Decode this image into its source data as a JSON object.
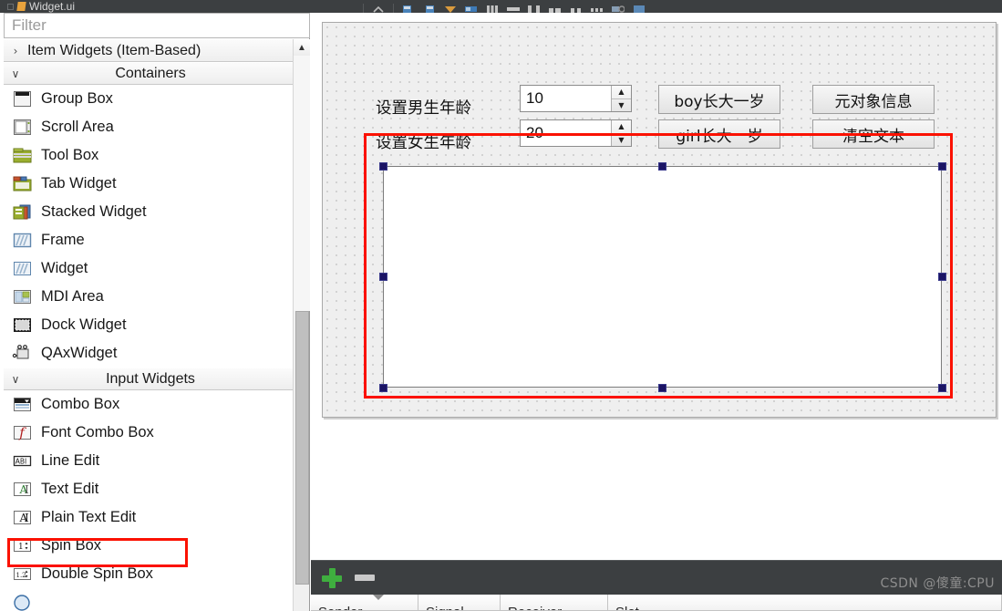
{
  "topbar": {
    "tab_label": "Widget.ui",
    "close_icon": "close-icon",
    "doc_icon": "ui-file-icon",
    "toolbar_icons": [
      "edit-widgets-icon",
      "edit-signals-icon",
      "edit-buddies-icon",
      "edit-tab-order-icon",
      "layout-horizontal-icon",
      "layout-vertical-icon",
      "layout-splitter-h-icon",
      "layout-splitter-v-icon",
      "layout-grid-icon",
      "layout-form-icon",
      "break-layout-icon",
      "adjust-size-icon"
    ]
  },
  "widget_box": {
    "filter": {
      "value": "",
      "placeholder": "Filter"
    },
    "groups": [
      {
        "title": "Item Widgets (Item-Based)",
        "expanded": false,
        "chevron": "chevron-right-icon",
        "align": "left",
        "items": []
      },
      {
        "title": "Containers",
        "expanded": true,
        "chevron": "chevron-down-icon",
        "align": "center",
        "items": [
          {
            "label": "Group Box",
            "icon": "group-box-icon"
          },
          {
            "label": "Scroll Area",
            "icon": "scroll-area-icon"
          },
          {
            "label": "Tool Box",
            "icon": "tool-box-icon"
          },
          {
            "label": "Tab Widget",
            "icon": "tab-widget-icon"
          },
          {
            "label": "Stacked Widget",
            "icon": "stacked-widget-icon"
          },
          {
            "label": "Frame",
            "icon": "frame-icon"
          },
          {
            "label": "Widget",
            "icon": "widget-icon"
          },
          {
            "label": "MDI Area",
            "icon": "mdi-area-icon"
          },
          {
            "label": "Dock Widget",
            "icon": "dock-widget-icon"
          },
          {
            "label": "QAxWidget",
            "icon": "qax-widget-icon"
          }
        ]
      },
      {
        "title": "Input Widgets",
        "expanded": true,
        "chevron": "chevron-down-icon",
        "align": "center",
        "items": [
          {
            "label": "Combo Box",
            "icon": "combo-box-icon"
          },
          {
            "label": "Font Combo Box",
            "icon": "font-combo-box-icon"
          },
          {
            "label": "Line Edit",
            "icon": "line-edit-icon"
          },
          {
            "label": "Text Edit",
            "icon": "text-edit-icon"
          },
          {
            "label": "Plain Text Edit",
            "icon": "plain-text-edit-icon",
            "highlighted": true
          },
          {
            "label": "Spin Box",
            "icon": "spin-box-icon"
          },
          {
            "label": "Double Spin Box",
            "icon": "double-spin-box-icon"
          }
        ]
      }
    ],
    "scrollbar": {
      "up_arrow": "chevron-up-icon"
    }
  },
  "form": {
    "labels": [
      {
        "text": "设置男生年龄"
      },
      {
        "text": "设置女生年龄"
      }
    ],
    "spinboxes": [
      {
        "value": "10",
        "up_icon": "spin-up-icon",
        "down_icon": "spin-down-icon"
      },
      {
        "value": "20",
        "up_icon": "spin-up-icon",
        "down_icon": "spin-down-icon"
      }
    ],
    "buttons": [
      {
        "label": "boy长大一岁"
      },
      {
        "label": "girl长大一岁"
      },
      {
        "label": "元对象信息"
      },
      {
        "label": "清空文本"
      }
    ],
    "plain_text_edit": {
      "text": "",
      "selected": true
    }
  },
  "signal_slot_editor": {
    "add_button": "add-icon",
    "remove_button": "remove-icon",
    "columns": [
      "Sender",
      "Signal",
      "Receiver",
      "Slot"
    ],
    "rows": []
  },
  "watermark": "CSDN @傻童:CPU",
  "colors": {
    "annotation": "#fb1100",
    "selection_handle": "#1b1464",
    "toolbar_dark": "#3c3f41",
    "add_green": "#3fae3f"
  }
}
